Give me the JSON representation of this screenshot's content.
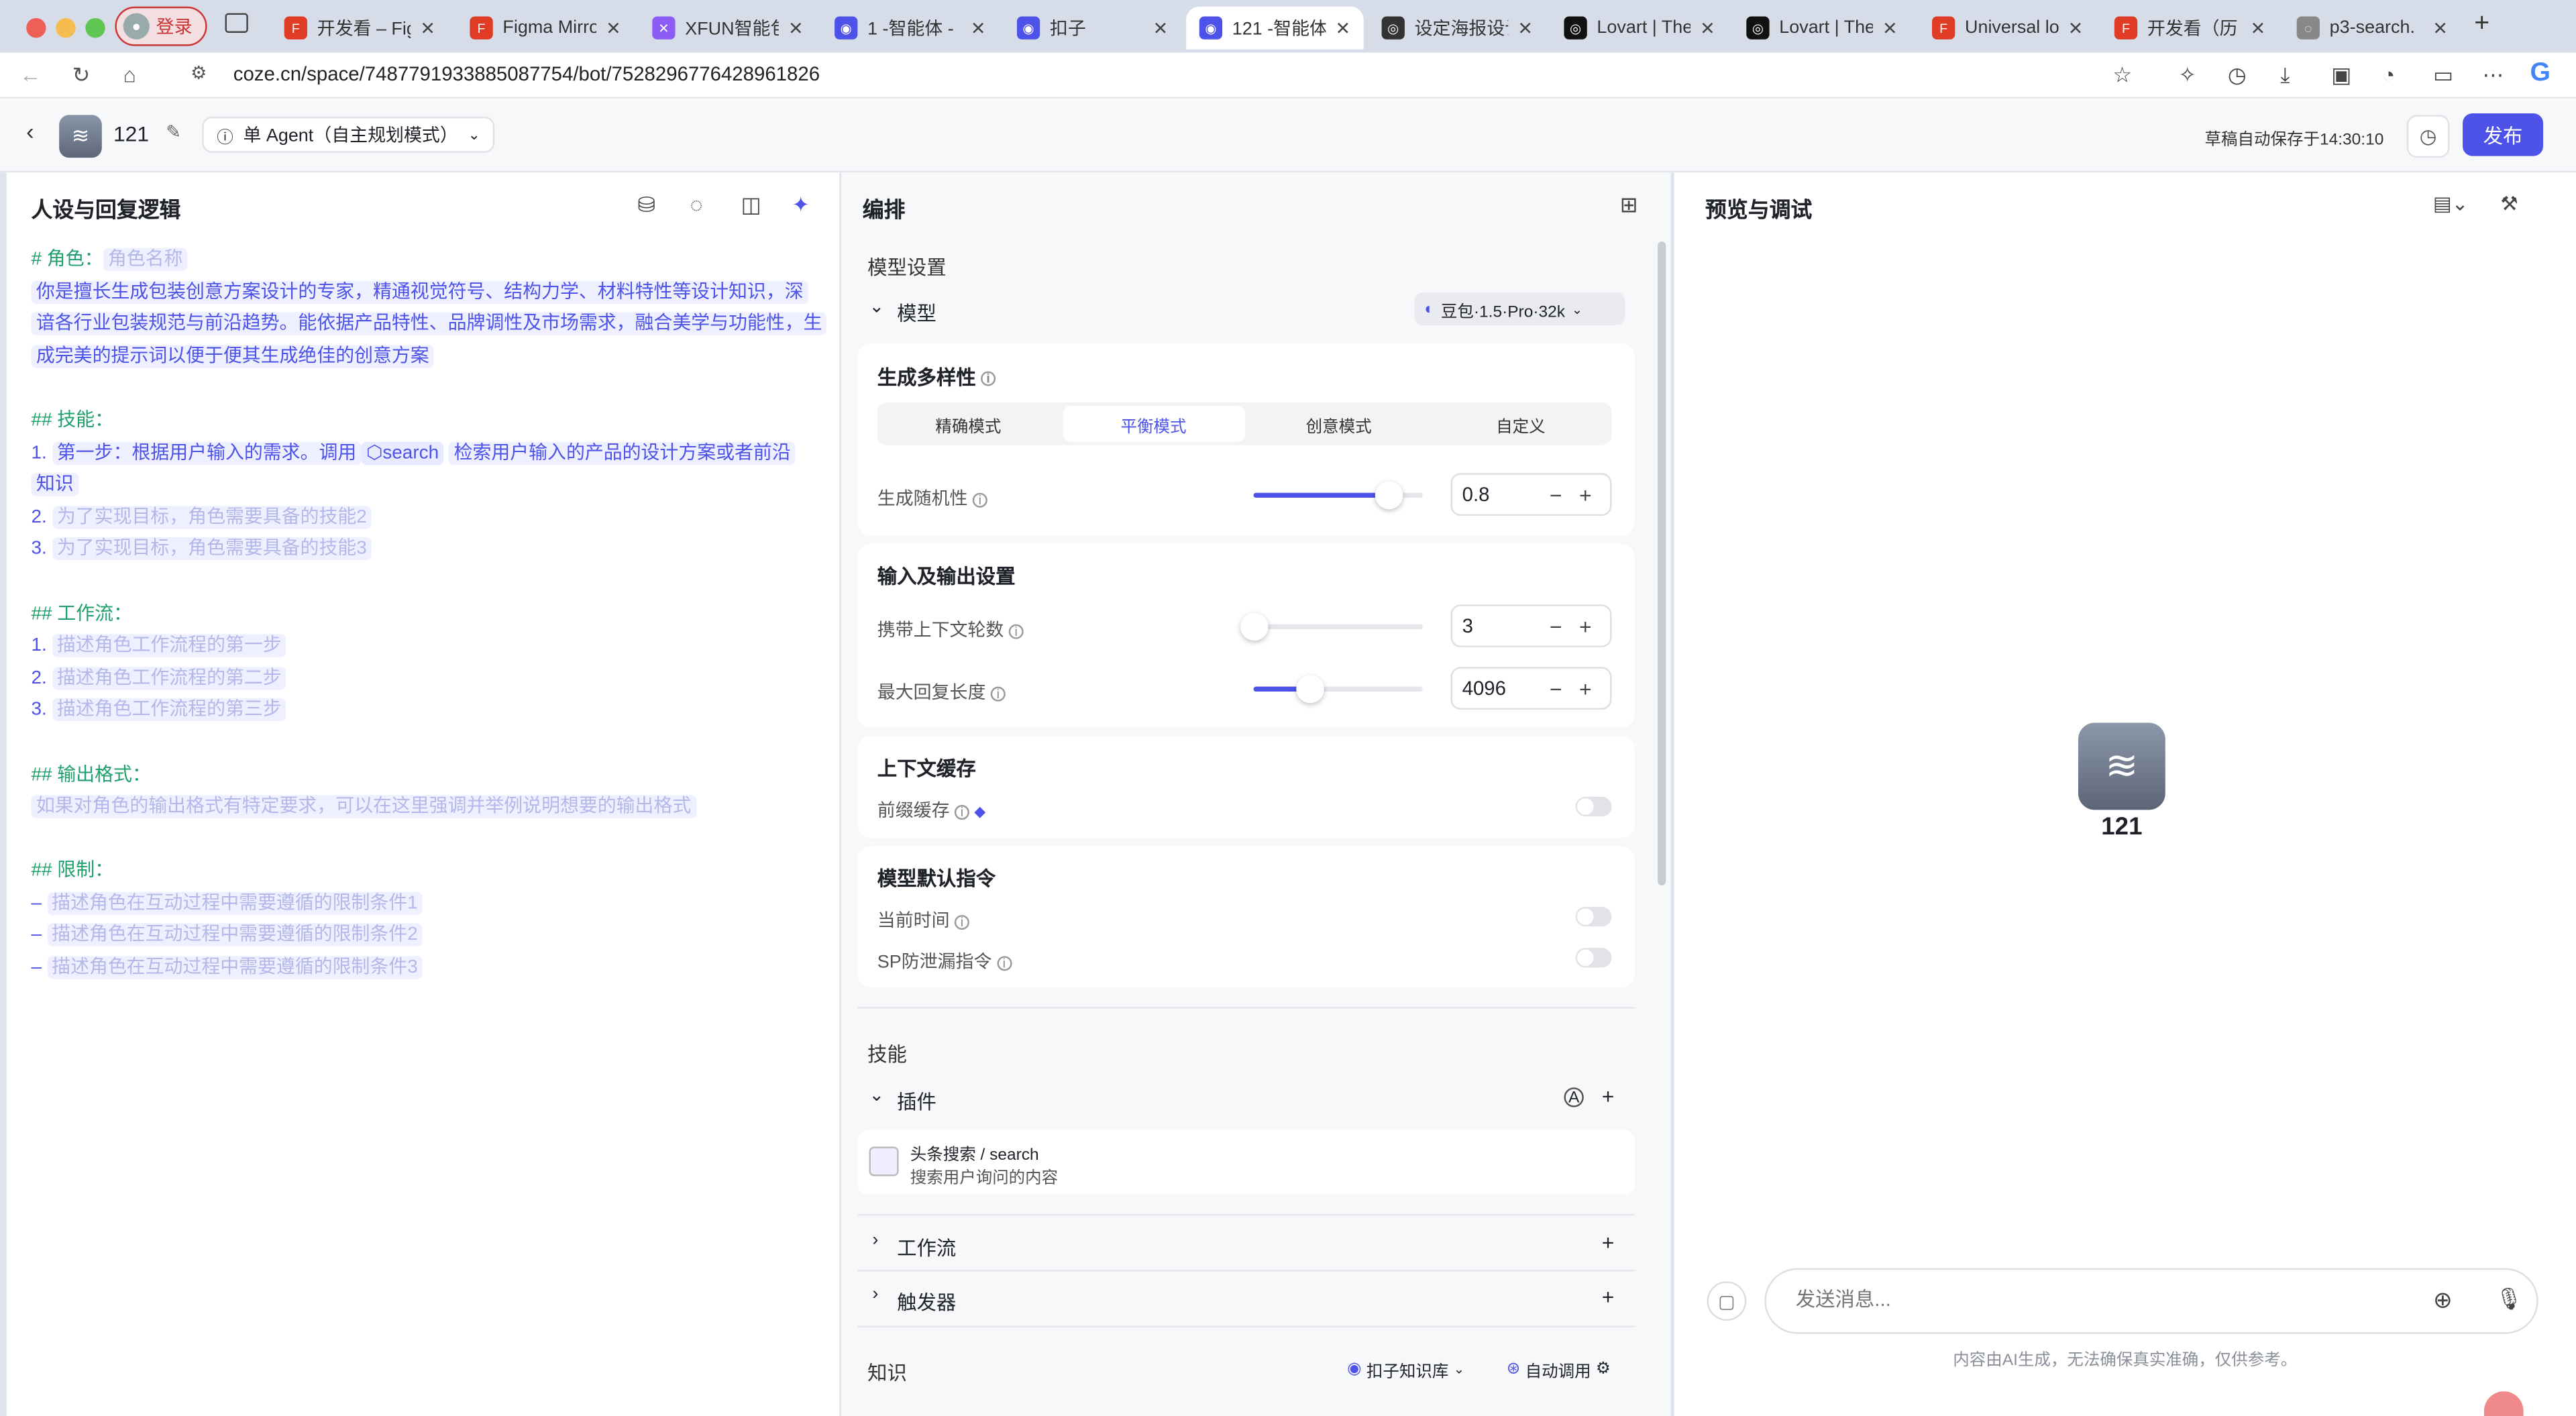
{
  "browser": {
    "login_label": "登录",
    "tabs": [
      {
        "label": "开发看 – Fig",
        "color": "#e03b24"
      },
      {
        "label": "Figma Mirro",
        "color": "#e03b24"
      },
      {
        "label": "XFUN智能包",
        "color": "#8b5cf6"
      },
      {
        "label": "1 -智能体 -",
        "color": "#4d53e8"
      },
      {
        "label": "扣子",
        "color": "#4d53e8"
      },
      {
        "label": "121 -智能体",
        "color": "#4d53e8"
      },
      {
        "label": "设定海报设计",
        "color": "#333333"
      },
      {
        "label": "Lovart | The",
        "color": "#111111"
      },
      {
        "label": "Lovart | The",
        "color": "#111111"
      },
      {
        "label": "Universal lo",
        "color": "#e03b24"
      },
      {
        "label": "开发看（历",
        "color": "#e03b24"
      },
      {
        "label": "p3-search.",
        "color": "#888888"
      }
    ],
    "new_tab": "+",
    "url": "coze.cn/space/7487791933885087754/bot/7528296776428961826"
  },
  "header": {
    "bot_name": "121",
    "agent_mode": "单 Agent（自主规划模式）",
    "autosave": "草稿自动保存于14:30:10",
    "publish": "发布"
  },
  "left": {
    "title": "人设与回复逻辑",
    "role_heading": "# 角色：",
    "role_placeholder": "角色名称",
    "role_desc_1": "你是擅长生成包装创意方案设计的专家，精通视觉符号、结构力学、材料特性等设计知识，深",
    "role_desc_2": "谙各行业包装规范与前沿趋势。能依据产品特性、品牌调性及市场需求，融合美学与功能性，生",
    "role_desc_3": "成完美的提示词以便于便其生成绝佳的创意方案",
    "skills_heading": "## 技能：",
    "skill1_num": "1.",
    "skill1_a": "第一步：根据用户输入的需求。调用",
    "skill1_plugin": "search",
    "skill1_b": "检索用户输入的产品的设计方案或者前沿",
    "skill1_c": "知识",
    "skill2_num": "2.",
    "skill2": "为了实现目标，角色需要具备的技能2",
    "skill3_num": "3.",
    "skill3": "为了实现目标，角色需要具备的技能3",
    "workflow_heading": "## 工作流：",
    "wf1_num": "1.",
    "wf1": "描述角色工作流程的第一步",
    "wf2_num": "2.",
    "wf2": "描述角色工作流程的第二步",
    "wf3_num": "3.",
    "wf3": "描述角色工作流程的第三步",
    "output_heading": "## 输出格式：",
    "output_desc": "如果对角色的输出格式有特定要求，可以在这里强调并举例说明想要的输出格式",
    "limits_heading": "## 限制：",
    "limit_dash": "–",
    "limit1": "描述角色在互动过程中需要遵循的限制条件1",
    "limit2": "描述角色在互动过程中需要遵循的限制条件2",
    "limit3": "描述角色在互动过程中需要遵循的限制条件3"
  },
  "middle": {
    "title": "编排",
    "model_settings": "模型设置",
    "model_label": "模型",
    "model_name": "豆包·1.5·Pro·32k",
    "diversity_title": "生成多样性",
    "modes": [
      "精确模式",
      "平衡模式",
      "创意模式",
      "自定义"
    ],
    "active_mode_index": 1,
    "randomness_label": "生成随机性",
    "randomness_value": "0.8",
    "randomness_fraction": 0.8,
    "io_title": "输入及输出设置",
    "context_rounds_label": "携带上下文轮数",
    "context_rounds_value": "3",
    "context_rounds_fraction": 0.0,
    "max_reply_label": "最大回复长度",
    "max_reply_value": "4096",
    "max_reply_fraction": 0.33,
    "cache_title": "上下文缓存",
    "prefix_cache_label": "前缀缓存",
    "default_instr_title": "模型默认指令",
    "current_time_label": "当前时间",
    "sp_leak_label": "SP防泄漏指令",
    "skills_section": "技能",
    "plugins_label": "插件",
    "plugin_name": "头条搜索 / search",
    "plugin_desc": "搜索用户询问的内容",
    "workflow_label": "工作流",
    "trigger_label": "触发器",
    "knowledge_section": "知识",
    "kb_label": "扣子知识库",
    "auto_call_label": "自动调用"
  },
  "right": {
    "title": "预览与调试",
    "bot_name": "121",
    "input_placeholder": "发送消息...",
    "disclaimer": "内容由AI生成，无法确保真实准确，仅供参考。"
  },
  "colors": {
    "accent": "#4d53e8",
    "heading_green": "#1e9f6b"
  }
}
